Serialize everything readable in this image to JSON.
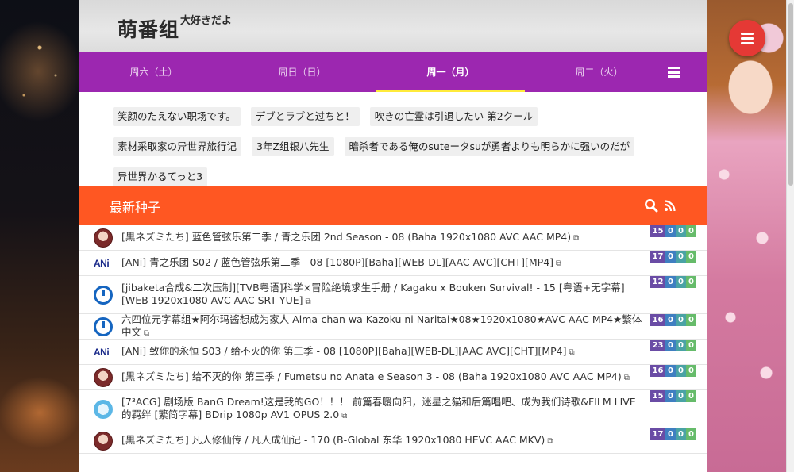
{
  "site": {
    "title": "萌番组",
    "subtitle": "大好きだよ"
  },
  "tabs": [
    {
      "label": "周六（土）",
      "active": false
    },
    {
      "label": "周日（日）",
      "active": false
    },
    {
      "label": "周一（月）",
      "active": true
    },
    {
      "label": "周二（火）",
      "active": false
    }
  ],
  "icons": {
    "menu": "hamburger-icon",
    "list": "list-icon",
    "search": "search-icon",
    "rss": "rss-icon",
    "external": "external-link-icon"
  },
  "anime": [
    "笑颜のたえない职场です。",
    "デブとラブと过ちと！",
    "吹きの亡霊は引退したい 第2クール",
    "素材采取家の异世界旅行记",
    "3年Z组银八先生",
    "暗杀者である俺のsuteータsuが勇者よりも明らかに强いのだが",
    "异世界かるてっと3"
  ],
  "latest": {
    "title": "最新种子",
    "torrents": [
      {
        "avatar": "kuro",
        "title": "[黒ネズミたち] 蓝色管弦乐第二季 / 青之乐团 2nd Season - 08 (Baha 1920x1080 AVC AAC MP4)",
        "stats": [
          "15",
          "0",
          "0",
          "0"
        ]
      },
      {
        "avatar": "ani",
        "title": "[ANi] 青之乐团 S02 / 蓝色管弦乐第二季 - 08 [1080P][Baha][WEB-DL][AAC AVC][CHT][MP4]",
        "stats": [
          "17",
          "0",
          "0",
          "0"
        ]
      },
      {
        "avatar": "power",
        "title": "[jibaketa合成&二次压制][TVB粤语]科学×冒险绝境求生手册 / Kagaku x Bouken Survival! - 15 [粤语+无字幕][WEB 1920x1080 AVC AAC SRT YUE]",
        "stats": [
          "12",
          "0",
          "0",
          "0"
        ]
      },
      {
        "avatar": "power",
        "title": "六四位元字幕组★阿尔玛酱想成为家人 Alma-chan wa Kazoku ni Naritai★08★1920x1080★AVC AAC MP4★繁体中文",
        "stats": [
          "16",
          "0",
          "0",
          "0"
        ]
      },
      {
        "avatar": "ani",
        "title": "[ANi] 致你的永恒 S03 / 给不灭的你 第三季 - 08 [1080P][Baha][WEB-DL][AAC AVC][CHT][MP4]",
        "stats": [
          "23",
          "0",
          "0",
          "0"
        ]
      },
      {
        "avatar": "kuro",
        "title": "[黒ネズミたち] 给不灭的你 第三季 / Fumetsu no Anata e Season 3 - 08 (Baha 1920x1080 AVC AAC MP4)",
        "stats": [
          "16",
          "0",
          "0",
          "0"
        ]
      },
      {
        "avatar": "7acg",
        "title": "[7³ACG] 剧场版 BanG Dream!这是我的GO！！！ 前篇春暖向阳，迷星之猫和后篇唱吧、成为我们诗歌&FILM LIVE的羁绊 [繁简字幕] BDrip 1080p AV1 OPUS 2.0",
        "stats": [
          "15",
          "0",
          "0",
          "0"
        ]
      },
      {
        "avatar": "kuro",
        "title": "[黒ネズミたち] 凡人修仙传 / 凡人成仙记 - 170 (B-Global 东华 1920x1080 HEVC AAC MKV)",
        "stats": [
          "17",
          "0",
          "0",
          "0"
        ]
      }
    ]
  }
}
